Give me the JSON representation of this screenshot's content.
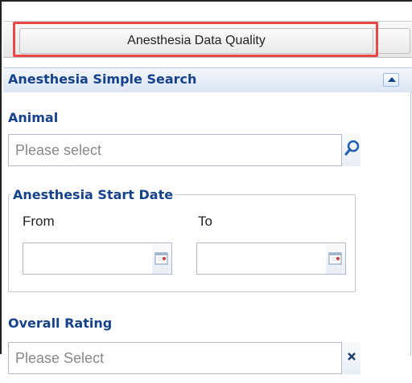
{
  "top_tab": {
    "label": "Anesthesia Data Quality"
  },
  "panel": {
    "title": "Anesthesia Simple Search",
    "collapse_icon": "chevron-up-icon"
  },
  "fields": {
    "animal": {
      "label": "Animal",
      "placeholder": "Please select",
      "trigger_icon": "search-icon"
    },
    "start_date": {
      "legend": "Anesthesia Start Date",
      "from_label": "From",
      "to_label": "To",
      "from_value": "",
      "to_value": "",
      "trigger_icon": "calendar-icon"
    },
    "overall_rating": {
      "label": "Overall Rating",
      "placeholder": "Please Select",
      "trigger_icon": "close-icon"
    }
  },
  "colors": {
    "accent": "#15428b",
    "highlight": "#e84848"
  }
}
